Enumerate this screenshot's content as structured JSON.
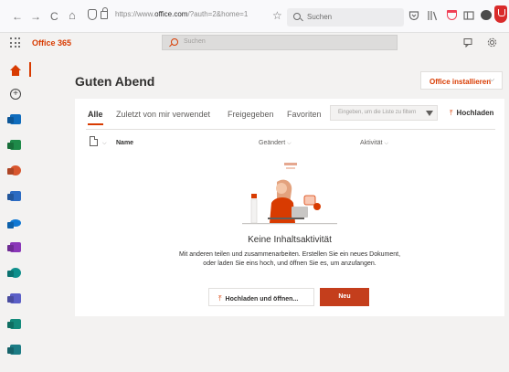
{
  "browser": {
    "back": "←",
    "forward": "→",
    "reload": "C",
    "home": "⌂",
    "url_domain": "office.com",
    "url_rest": "/?auth=2&home=1",
    "url_prefix": "https://www.",
    "star": "☆",
    "search_placeholder": "Suchen",
    "toolbar_icons": [
      "pocket-icon",
      "library-icon",
      "sidebar-icon",
      "reader-icon",
      "extension-icon",
      "ublock-icon"
    ]
  },
  "header": {
    "brand": "Office 365",
    "search_placeholder": "Suchen",
    "icons": [
      "feedback-icon",
      "settings-icon"
    ]
  },
  "rail": {
    "items": [
      "home",
      "create",
      "outlook",
      "excel",
      "powerpoint",
      "sway",
      "onedrive",
      "onenote",
      "sharepoint",
      "teams",
      "sway-2",
      "yammer"
    ],
    "accent": "#d83b01"
  },
  "main": {
    "greeting": "Guten Abend",
    "install_label": "Office installieren",
    "tabs": [
      "Alle",
      "Zuletzt von mir verwendet",
      "Freigegeben",
      "Favoriten"
    ],
    "filter_placeholder": "Eingeben, um die Liste zu filtern",
    "upload_label": "Hochladen",
    "columns": [
      "Name",
      "Geändert",
      "Aktivität"
    ],
    "empty_title": "Keine Inhaltsaktivität",
    "empty_desc": "Mit anderen teilen und zusammenarbeiten. Erstellen Sie ein neues Dokument, oder laden Sie eins hoch, und öffnen Sie es, um anzufangen.",
    "upload_open_label": "Hochladen und öffnen...",
    "new_label": "Neu"
  }
}
